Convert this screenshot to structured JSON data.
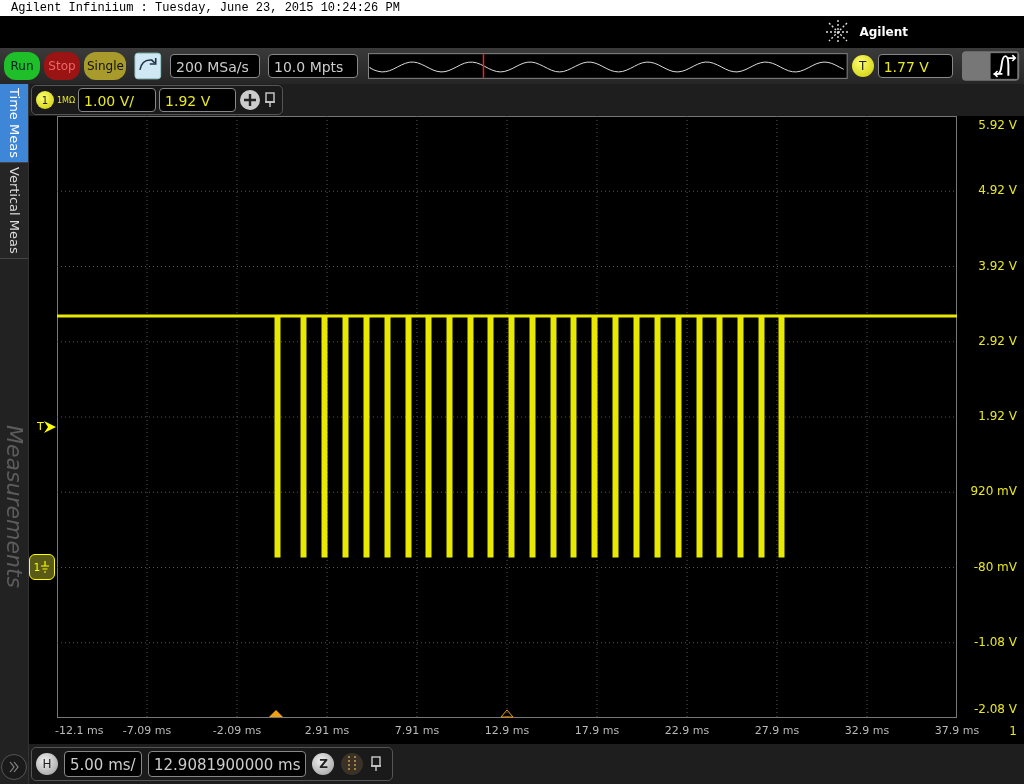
{
  "window": {
    "title": "Agilent Infiniium : Tuesday, June 23, 2015 10:24:26 PM"
  },
  "brand": {
    "name": "Agilent"
  },
  "toolbar": {
    "buttons": [
      {
        "label": "Run",
        "kind": "run"
      },
      {
        "label": "Stop",
        "kind": "stop"
      },
      {
        "label": "Single",
        "kind": "single"
      }
    ],
    "sample_rate": "200 MSa/s",
    "memory_depth": "10.0 Mpts",
    "trigger": {
      "label": "T",
      "level": "1.77 V"
    }
  },
  "channel": {
    "number": "1",
    "impedance": "1MΩ",
    "scale": "1.00 V/",
    "offset": "1.92 V"
  },
  "side_tabs": [
    {
      "label": "Time Meas",
      "selected": true
    },
    {
      "label": "Vertical Meas",
      "selected": false
    }
  ],
  "side_panel": {
    "title": "Measurements"
  },
  "plot": {
    "trigger_marker": "T",
    "channel_marker": "1",
    "axis_channel": "1",
    "y_labels": [
      "5.92 V",
      "4.92 V",
      "3.92 V",
      "2.92 V",
      "1.92 V",
      "920 mV",
      "-80 mV",
      "-1.08 V",
      "-2.08 V"
    ],
    "x_labels": [
      "-12.1 ms",
      "-7.09 ms",
      "-2.09 ms",
      "2.91 ms",
      "7.91 ms",
      "12.9 ms",
      "17.9 ms",
      "22.9 ms",
      "27.9 ms",
      "32.9 ms",
      "37.9 ms"
    ]
  },
  "horizontal": {
    "label": "H",
    "scale": "5.00 ms/",
    "position": "12.9081900000 ms",
    "zoom_label": "Z"
  }
}
